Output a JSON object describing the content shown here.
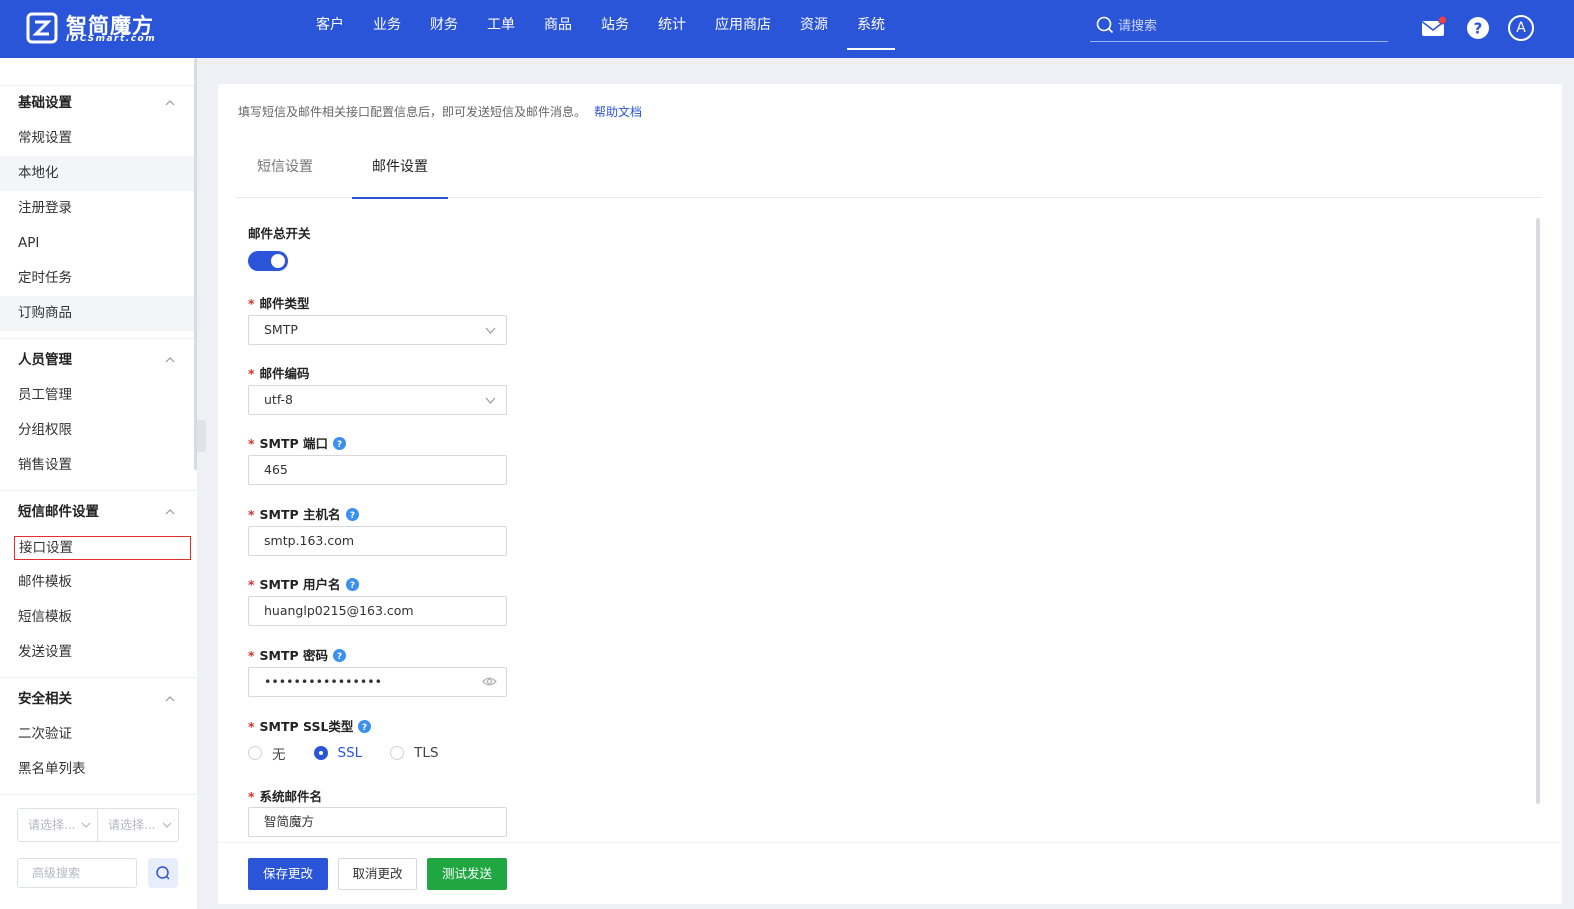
{
  "brand": {
    "name": "智简魔方",
    "sub": "IDCSmart.com"
  },
  "nav": [
    "客户",
    "业务",
    "财务",
    "工单",
    "商品",
    "站务",
    "统计",
    "应用商店",
    "资源",
    "系统"
  ],
  "nav_active_index": 9,
  "search": {
    "placeholder": "请搜索"
  },
  "user": {
    "avatar_letter": "A"
  },
  "colors": {
    "primary": "#2b55d9",
    "success": "#20a742",
    "danger": "#e02f2f"
  },
  "sidebar": {
    "groups": [
      {
        "title": "基础设置",
        "items": [
          "常规设置",
          "本地化",
          "注册登录",
          "API",
          "定时任务",
          "订购商品"
        ]
      },
      {
        "title": "人员管理",
        "items": [
          "员工管理",
          "分组权限",
          "销售设置"
        ]
      },
      {
        "title": "短信邮件设置",
        "items": [
          "接口设置",
          "邮件模板",
          "短信模板",
          "发送设置"
        ]
      },
      {
        "title": "安全相关",
        "items": [
          "二次验证",
          "黑名单列表"
        ]
      }
    ],
    "selected_item": "接口设置",
    "select_1": "请选择...",
    "select_2": "请选择...",
    "advanced_search": "高级搜索"
  },
  "notice": {
    "text": "填写短信及邮件相关接口配置信息后，即可发送短信及邮件消息。",
    "link": "帮助文档"
  },
  "tabs": {
    "sms": "短信设置",
    "mail": "邮件设置",
    "active": "邮件设置"
  },
  "form": {
    "master_switch": {
      "label": "邮件总开关",
      "on": true
    },
    "mail_type": {
      "label": "邮件类型",
      "value": "SMTP"
    },
    "mail_encoding": {
      "label": "邮件编码",
      "value": "utf-8"
    },
    "smtp_port": {
      "label": "SMTP 端口",
      "value": "465"
    },
    "smtp_host": {
      "label": "SMTP 主机名",
      "value": "smtp.163.com"
    },
    "smtp_user": {
      "label": "SMTP 用户名",
      "value": "huanglp0215@163.com"
    },
    "smtp_password": {
      "label": "SMTP 密码",
      "value": "••••••••••••••••"
    },
    "smtp_ssl": {
      "label": "SMTP SSL类型",
      "options": [
        "无",
        "SSL",
        "TLS"
      ],
      "selected": "SSL"
    },
    "system_mail_name": {
      "label": "系统邮件名",
      "value": "智简魔方"
    }
  },
  "buttons": {
    "save": "保存更改",
    "cancel": "取消更改",
    "test": "测试发送"
  }
}
